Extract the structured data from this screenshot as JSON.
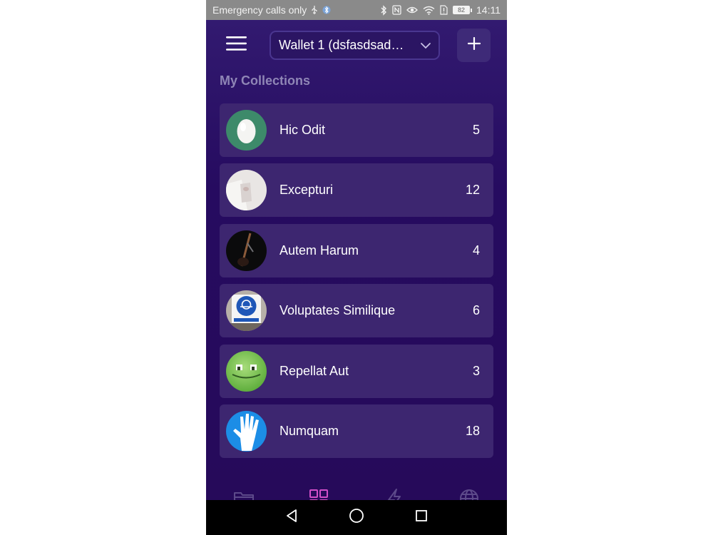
{
  "status_bar": {
    "carrier_text": "Emergency calls only",
    "battery": "82",
    "time": "14:11",
    "icons": [
      "usb-icon",
      "bluetooth-icon",
      "nfc-icon",
      "eye-icon",
      "wifi-icon",
      "sim-alert-icon",
      "battery-icon"
    ]
  },
  "header": {
    "menu_icon": "hamburger-icon",
    "wallet_label": "Wallet 1 (dsfasdsad…",
    "wallet_chevron": "chevron-down-icon",
    "add_icon": "plus-icon"
  },
  "section_title": "My Collections",
  "collections": [
    {
      "name": "Hic Odit",
      "count": "5",
      "avatar": "egg-avatar"
    },
    {
      "name": "Excepturi",
      "count": "12",
      "avatar": "photo-avatar"
    },
    {
      "name": "Autem Harum",
      "count": "4",
      "avatar": "guitar-avatar"
    },
    {
      "name": "Voluptates Similique",
      "count": "6",
      "avatar": "safety-sign-avatar"
    },
    {
      "name": "Repellat Aut",
      "count": "3",
      "avatar": "green-face-avatar"
    },
    {
      "name": "Numquam",
      "count": "18",
      "avatar": "hand-avatar"
    }
  ],
  "tabs": [
    {
      "name": "folder",
      "icon": "folder-icon",
      "active": false
    },
    {
      "name": "collections",
      "icon": "grid-icon",
      "active": true
    },
    {
      "name": "activity",
      "icon": "lightning-icon",
      "active": false
    },
    {
      "name": "browser",
      "icon": "globe-icon",
      "active": false
    }
  ],
  "colors": {
    "background": "#2a0f5c",
    "card": "#3d2670",
    "active_tab": "#d24fc8",
    "inactive_tab": "#5d4a8a",
    "section_title": "#8f86b6"
  }
}
